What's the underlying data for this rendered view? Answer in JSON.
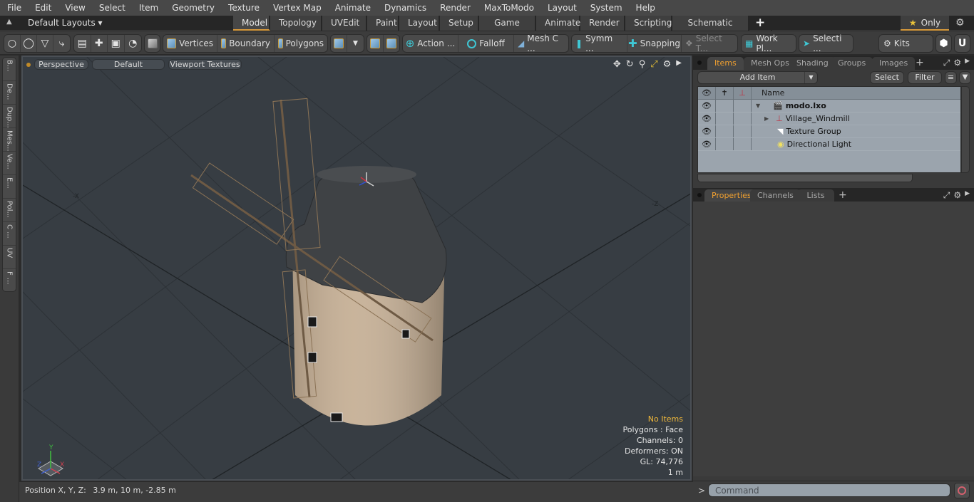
{
  "menu": [
    "File",
    "Edit",
    "View",
    "Select",
    "Item",
    "Geometry",
    "Texture",
    "Vertex Map",
    "Animate",
    "Dynamics",
    "Render",
    "MaxToModo",
    "Layout",
    "System",
    "Help"
  ],
  "layoutbar": {
    "layouts_label": "Default Layouts ▾",
    "tabs": [
      "Model",
      "Topology",
      "UVEdit",
      "Paint",
      "Layout",
      "Setup",
      "Game Tools",
      "Animate",
      "Render",
      "Scripting",
      "Schematic Fusion"
    ],
    "active_tab": "Model",
    "plus": "+",
    "only_label": "Only"
  },
  "toolbar": {
    "vertices": "Vertices",
    "boundary": "Boundary",
    "polygons": "Polygons",
    "action": "Action",
    "falloff": "Falloff",
    "mesh_c": "Mesh C ...",
    "symm": "Symm ...",
    "snapping": "Snapping",
    "select_t": "Select T...",
    "work_pl": "Work Pl...",
    "selecti": "Selecti ...",
    "kits": "Kits",
    "ellipsis": "..."
  },
  "left_tabs": [
    "B...",
    "De...",
    "Dup...",
    "Mes...",
    "Ve...",
    "E...",
    "Pol...",
    "C ...",
    "UV",
    "F ..."
  ],
  "viewport": {
    "view_mode": "Perspective",
    "shading": "Default",
    "textures": "Viewport Textures",
    "axis_neg_x": "-X",
    "axis_neg_z": "-Z",
    "gizmo": {
      "y": "Y",
      "x": "X",
      "z": "Z"
    },
    "hud": {
      "selection": "No Items",
      "polygons": "Polygons : Face",
      "channels": "Channels: 0",
      "deformers": "Deformers: ON",
      "gl": "GL: 74,776",
      "scale": "1 m"
    }
  },
  "status": {
    "position_label": "Position X, Y, Z:",
    "position_value": "3.9 m, 10 m, -2.85 m"
  },
  "items_panel": {
    "tabs": [
      "Items",
      "Mesh Ops",
      "Shading",
      "Groups",
      "Images"
    ],
    "active_tab": "Items",
    "add_item": "Add Item",
    "select": "Select",
    "filter": "Filter",
    "column_name": "Name",
    "rows": [
      {
        "name": "modo.lxo",
        "icon": "scene-icon",
        "bold": true,
        "expander": "▼"
      },
      {
        "name": "Village_Windmill",
        "icon": "locator-icon",
        "bold": false,
        "expander": "▶"
      },
      {
        "name": "Texture Group",
        "icon": "texture-group-icon",
        "bold": false,
        "expander": ""
      },
      {
        "name": "Directional Light",
        "icon": "light-icon",
        "bold": false,
        "expander": ""
      }
    ]
  },
  "properties_panel": {
    "tabs": [
      "Properties",
      "Channels",
      "Lists"
    ],
    "active_tab": "Properties"
  },
  "command": {
    "prompt": ">",
    "placeholder": "Command"
  },
  "colors": {
    "accent": "#d89a3c",
    "active_tab_text": "#f0a030",
    "viewport_bg": "#373d43",
    "list_bg": "#9ba4ad"
  }
}
